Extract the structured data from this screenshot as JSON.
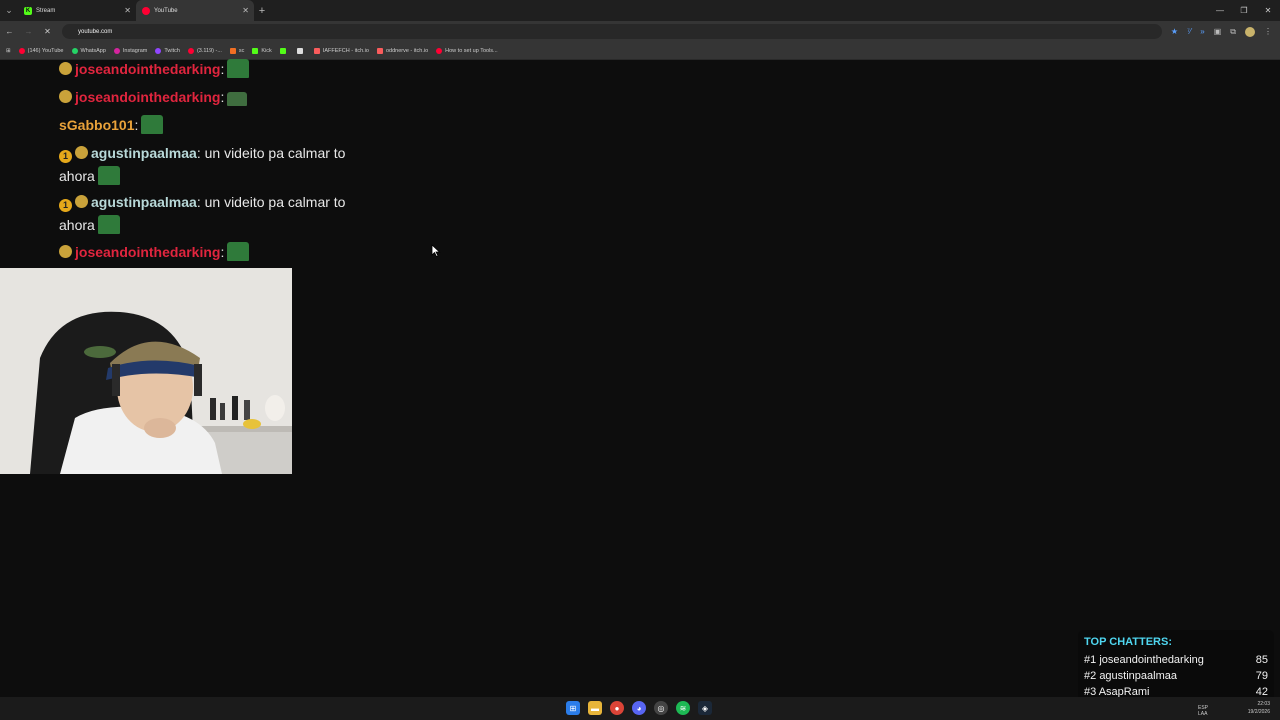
{
  "browser": {
    "tabs": [
      {
        "label": "Stream",
        "favicon": "kick-icon",
        "active": false
      },
      {
        "label": "YouTube",
        "favicon": "youtube-icon",
        "active": true
      }
    ],
    "url": "youtube.com",
    "bookmarks": [
      {
        "label": "(146) YouTube",
        "icon": "youtube-icon"
      },
      {
        "label": "WhatsApp",
        "icon": "whatsapp-icon"
      },
      {
        "label": "Instagram",
        "icon": "instagram-icon"
      },
      {
        "label": "Twitch",
        "icon": "twitch-icon"
      },
      {
        "label": "(3.119) -...",
        "icon": "youtube-icon"
      },
      {
        "label": "sc",
        "icon": "sc-icon"
      },
      {
        "label": "Kick",
        "icon": "kick-icon"
      },
      {
        "label": "",
        "icon": "kick-icon"
      },
      {
        "label": "",
        "icon": "v-icon"
      },
      {
        "label": "IAFFEFCH - itch.io",
        "icon": "itch-icon"
      },
      {
        "label": "oddnerve - itch.io",
        "icon": "itch-icon"
      },
      {
        "label": "How to set up Tools...",
        "icon": "youtube-icon"
      }
    ]
  },
  "chat": {
    "messages": [
      {
        "user": "joseandointhedarking",
        "text": ""
      },
      {
        "user": "joseandointhedarking",
        "text": ""
      },
      {
        "user": "sGabbo101",
        "text": ""
      },
      {
        "user": "agustinpaalmaa",
        "text": "un videito pa calmar to",
        "text2": "ahora"
      },
      {
        "user": "agustinpaalmaa",
        "text": "un videito pa calmar to",
        "text2": "ahora"
      },
      {
        "user": "joseandointhedarking",
        "text": ""
      }
    ]
  },
  "top_chatters": {
    "title": "TOP CHATTERS:",
    "rows": [
      {
        "rank": "#1",
        "name": "joseandointhedarking",
        "count": "85"
      },
      {
        "rank": "#2",
        "name": "agustinpaalmaa",
        "count": "79"
      },
      {
        "rank": "#3",
        "name": "AsapRami",
        "count": "42"
      }
    ]
  },
  "taskbar": {
    "lang": "LAA",
    "lang2": "ESP",
    "time": "22:03",
    "date": "19/2/2026"
  },
  "colors": {
    "username_red": "#e0253e",
    "username_orange": "#e9a23a",
    "top_chatters_title": "#4fd6f0"
  }
}
